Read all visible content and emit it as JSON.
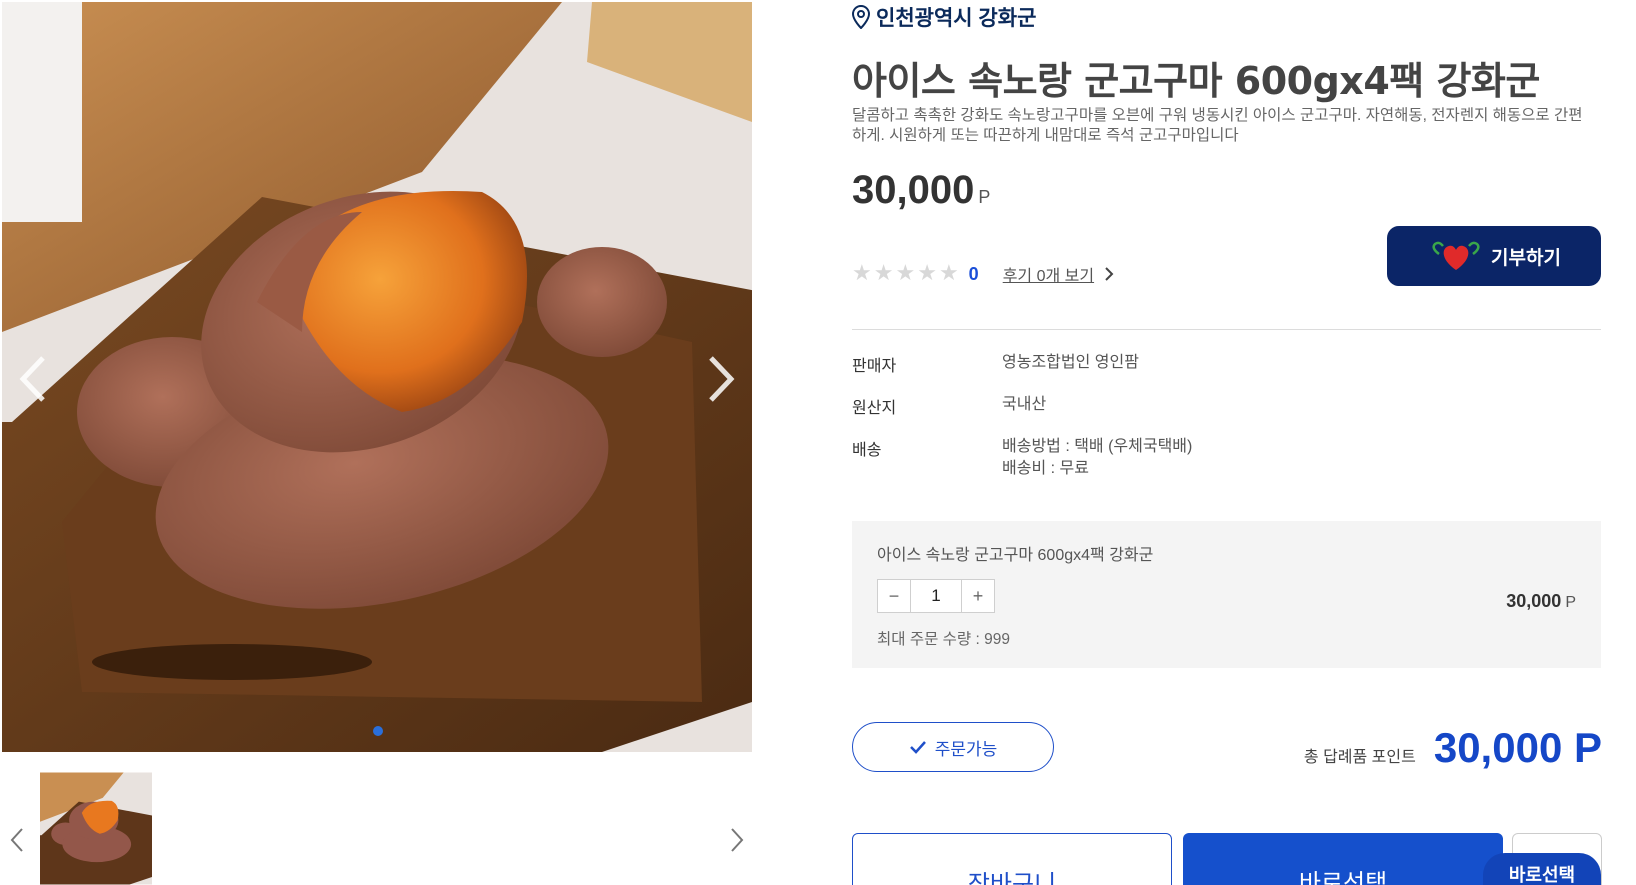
{
  "gallery": {
    "main_image_alt": "군고구마",
    "slide_count": 1,
    "active_slide": 1
  },
  "product": {
    "region": "인천광역시 강화군",
    "title": "아이스 속노랑 군고구마 600gx4팩 강화군",
    "description": "달콤하고 촉촉한 강화도 속노랑고구마를 오븐에 구워 냉동시킨 아이스 군고구마. 자연해동, 전자렌지 해동으로 간편하게. 시원하게 또는 따끈하게 내맘대로 즉석 군고구마입니다",
    "price": "30,000",
    "price_unit": "P",
    "rating_count": "0",
    "review_link": "후기 0개 보기",
    "donate_label": "기부하기"
  },
  "specs": [
    {
      "key": "판매자",
      "value": "영농조합법인 영인팜"
    },
    {
      "key": "원산지",
      "value": "국내산"
    },
    {
      "key": "배송",
      "value": "배송방법 : 택배 (우체국택배)",
      "value2": "배송비 : 무료"
    }
  ],
  "option": {
    "name": "아이스 속노랑 군고구마 600gx4팩 강화군",
    "quantity": "1",
    "minus": "−",
    "plus": "+",
    "max_order": "최대 주문 수량 : 999",
    "price": "30,000",
    "price_unit": "P"
  },
  "summary": {
    "availability": "주문가능",
    "total_label": "총 답례품 포인트",
    "total_value": "30,000 P"
  },
  "actions": {
    "cart": "장바구니",
    "buy": "바로선택",
    "float_buy": "바로선택"
  },
  "colors": {
    "navy": "#0b2567",
    "primary": "#1550cc",
    "accent_blue": "#1547c7"
  }
}
